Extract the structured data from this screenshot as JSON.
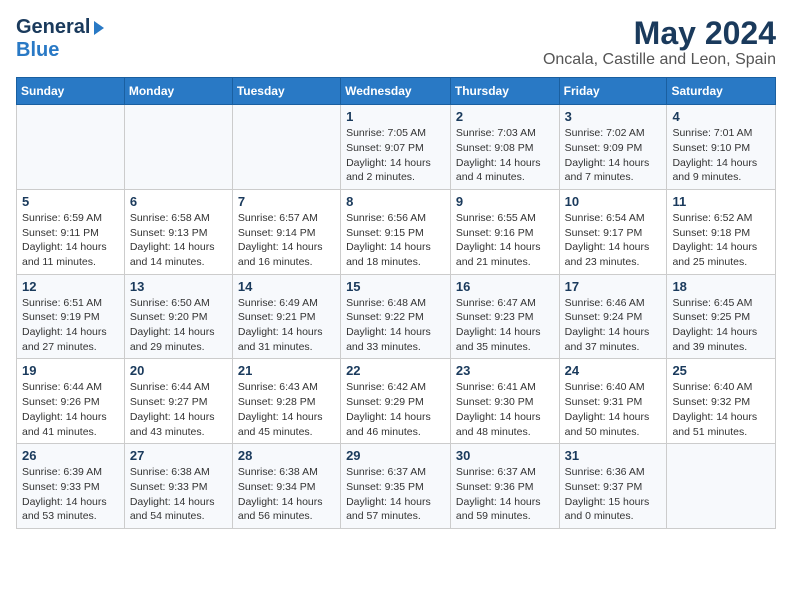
{
  "logo": {
    "line1": "General",
    "line2": "Blue"
  },
  "title": "May 2024",
  "subtitle": "Oncala, Castille and Leon, Spain",
  "days_of_week": [
    "Sunday",
    "Monday",
    "Tuesday",
    "Wednesday",
    "Thursday",
    "Friday",
    "Saturday"
  ],
  "weeks": [
    [
      {
        "day": "",
        "info": ""
      },
      {
        "day": "",
        "info": ""
      },
      {
        "day": "",
        "info": ""
      },
      {
        "day": "1",
        "info": "Sunrise: 7:05 AM\nSunset: 9:07 PM\nDaylight: 14 hours\nand 2 minutes."
      },
      {
        "day": "2",
        "info": "Sunrise: 7:03 AM\nSunset: 9:08 PM\nDaylight: 14 hours\nand 4 minutes."
      },
      {
        "day": "3",
        "info": "Sunrise: 7:02 AM\nSunset: 9:09 PM\nDaylight: 14 hours\nand 7 minutes."
      },
      {
        "day": "4",
        "info": "Sunrise: 7:01 AM\nSunset: 9:10 PM\nDaylight: 14 hours\nand 9 minutes."
      }
    ],
    [
      {
        "day": "5",
        "info": "Sunrise: 6:59 AM\nSunset: 9:11 PM\nDaylight: 14 hours\nand 11 minutes."
      },
      {
        "day": "6",
        "info": "Sunrise: 6:58 AM\nSunset: 9:13 PM\nDaylight: 14 hours\nand 14 minutes."
      },
      {
        "day": "7",
        "info": "Sunrise: 6:57 AM\nSunset: 9:14 PM\nDaylight: 14 hours\nand 16 minutes."
      },
      {
        "day": "8",
        "info": "Sunrise: 6:56 AM\nSunset: 9:15 PM\nDaylight: 14 hours\nand 18 minutes."
      },
      {
        "day": "9",
        "info": "Sunrise: 6:55 AM\nSunset: 9:16 PM\nDaylight: 14 hours\nand 21 minutes."
      },
      {
        "day": "10",
        "info": "Sunrise: 6:54 AM\nSunset: 9:17 PM\nDaylight: 14 hours\nand 23 minutes."
      },
      {
        "day": "11",
        "info": "Sunrise: 6:52 AM\nSunset: 9:18 PM\nDaylight: 14 hours\nand 25 minutes."
      }
    ],
    [
      {
        "day": "12",
        "info": "Sunrise: 6:51 AM\nSunset: 9:19 PM\nDaylight: 14 hours\nand 27 minutes."
      },
      {
        "day": "13",
        "info": "Sunrise: 6:50 AM\nSunset: 9:20 PM\nDaylight: 14 hours\nand 29 minutes."
      },
      {
        "day": "14",
        "info": "Sunrise: 6:49 AM\nSunset: 9:21 PM\nDaylight: 14 hours\nand 31 minutes."
      },
      {
        "day": "15",
        "info": "Sunrise: 6:48 AM\nSunset: 9:22 PM\nDaylight: 14 hours\nand 33 minutes."
      },
      {
        "day": "16",
        "info": "Sunrise: 6:47 AM\nSunset: 9:23 PM\nDaylight: 14 hours\nand 35 minutes."
      },
      {
        "day": "17",
        "info": "Sunrise: 6:46 AM\nSunset: 9:24 PM\nDaylight: 14 hours\nand 37 minutes."
      },
      {
        "day": "18",
        "info": "Sunrise: 6:45 AM\nSunset: 9:25 PM\nDaylight: 14 hours\nand 39 minutes."
      }
    ],
    [
      {
        "day": "19",
        "info": "Sunrise: 6:44 AM\nSunset: 9:26 PM\nDaylight: 14 hours\nand 41 minutes."
      },
      {
        "day": "20",
        "info": "Sunrise: 6:44 AM\nSunset: 9:27 PM\nDaylight: 14 hours\nand 43 minutes."
      },
      {
        "day": "21",
        "info": "Sunrise: 6:43 AM\nSunset: 9:28 PM\nDaylight: 14 hours\nand 45 minutes."
      },
      {
        "day": "22",
        "info": "Sunrise: 6:42 AM\nSunset: 9:29 PM\nDaylight: 14 hours\nand 46 minutes."
      },
      {
        "day": "23",
        "info": "Sunrise: 6:41 AM\nSunset: 9:30 PM\nDaylight: 14 hours\nand 48 minutes."
      },
      {
        "day": "24",
        "info": "Sunrise: 6:40 AM\nSunset: 9:31 PM\nDaylight: 14 hours\nand 50 minutes."
      },
      {
        "day": "25",
        "info": "Sunrise: 6:40 AM\nSunset: 9:32 PM\nDaylight: 14 hours\nand 51 minutes."
      }
    ],
    [
      {
        "day": "26",
        "info": "Sunrise: 6:39 AM\nSunset: 9:33 PM\nDaylight: 14 hours\nand 53 minutes."
      },
      {
        "day": "27",
        "info": "Sunrise: 6:38 AM\nSunset: 9:33 PM\nDaylight: 14 hours\nand 54 minutes."
      },
      {
        "day": "28",
        "info": "Sunrise: 6:38 AM\nSunset: 9:34 PM\nDaylight: 14 hours\nand 56 minutes."
      },
      {
        "day": "29",
        "info": "Sunrise: 6:37 AM\nSunset: 9:35 PM\nDaylight: 14 hours\nand 57 minutes."
      },
      {
        "day": "30",
        "info": "Sunrise: 6:37 AM\nSunset: 9:36 PM\nDaylight: 14 hours\nand 59 minutes."
      },
      {
        "day": "31",
        "info": "Sunrise: 6:36 AM\nSunset: 9:37 PM\nDaylight: 15 hours\nand 0 minutes."
      },
      {
        "day": "",
        "info": ""
      }
    ]
  ]
}
